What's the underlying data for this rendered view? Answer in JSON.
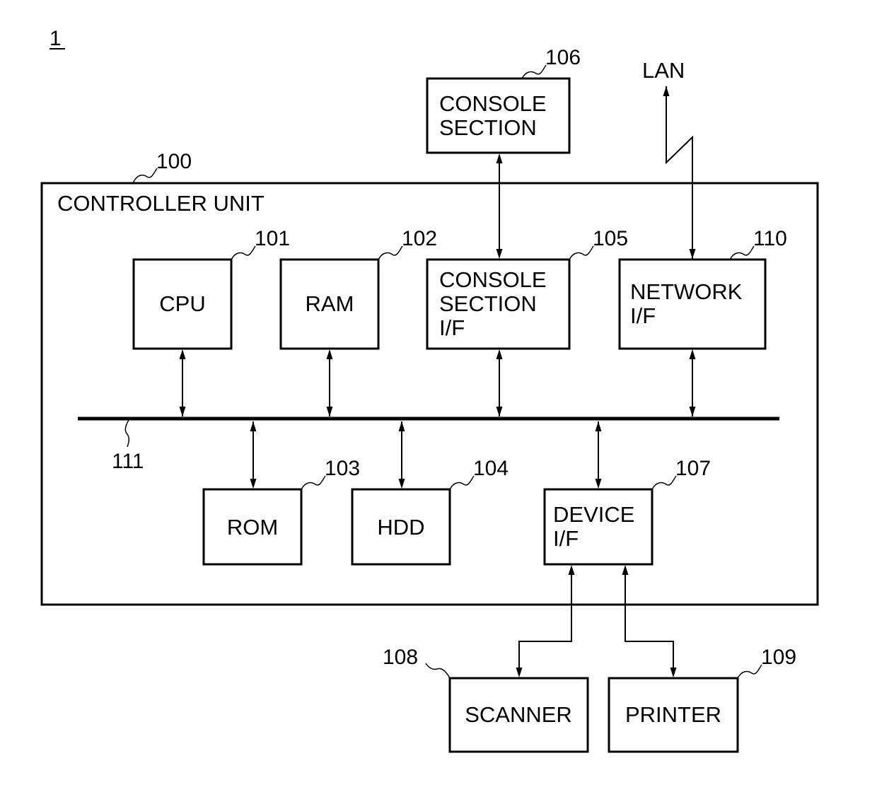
{
  "figure": {
    "number": "1",
    "colors": {
      "ink": "#000000",
      "background": "#ffffff"
    }
  },
  "controller_unit": {
    "ref": "100",
    "title": "CONTROLLER UNIT"
  },
  "bus": {
    "ref": "111"
  },
  "lan": {
    "label": "LAN"
  },
  "blocks": {
    "cpu": {
      "ref": "101",
      "lines": [
        "CPU"
      ]
    },
    "ram": {
      "ref": "102",
      "lines": [
        "RAM"
      ]
    },
    "rom": {
      "ref": "103",
      "lines": [
        "ROM"
      ]
    },
    "hdd": {
      "ref": "104",
      "lines": [
        "HDD"
      ]
    },
    "console_if": {
      "ref": "105",
      "lines": [
        "CONSOLE",
        "SECTION",
        "I/F"
      ]
    },
    "console": {
      "ref": "106",
      "lines": [
        "CONSOLE",
        "SECTION"
      ]
    },
    "device_if": {
      "ref": "107",
      "lines": [
        "DEVICE",
        "I/F"
      ]
    },
    "scanner": {
      "ref": "108",
      "lines": [
        "SCANNER"
      ]
    },
    "printer": {
      "ref": "109",
      "lines": [
        "PRINTER"
      ]
    },
    "network_if": {
      "ref": "110",
      "lines": [
        "NETWORK",
        "I/F"
      ]
    }
  },
  "connections": [
    {
      "from": "cpu",
      "to": "bus",
      "direction": "bidirectional"
    },
    {
      "from": "ram",
      "to": "bus",
      "direction": "bidirectional"
    },
    {
      "from": "console_if",
      "to": "bus",
      "direction": "bidirectional"
    },
    {
      "from": "network_if",
      "to": "bus",
      "direction": "bidirectional"
    },
    {
      "from": "rom",
      "to": "bus",
      "direction": "bidirectional"
    },
    {
      "from": "hdd",
      "to": "bus",
      "direction": "bidirectional"
    },
    {
      "from": "device_if",
      "to": "bus",
      "direction": "bidirectional"
    },
    {
      "from": "console",
      "to": "console_if",
      "direction": "bidirectional"
    },
    {
      "from": "network_if",
      "to": "lan",
      "direction": "bidirectional"
    },
    {
      "from": "device_if",
      "to": "scanner",
      "direction": "bidirectional"
    },
    {
      "from": "device_if",
      "to": "printer",
      "direction": "bidirectional"
    }
  ]
}
